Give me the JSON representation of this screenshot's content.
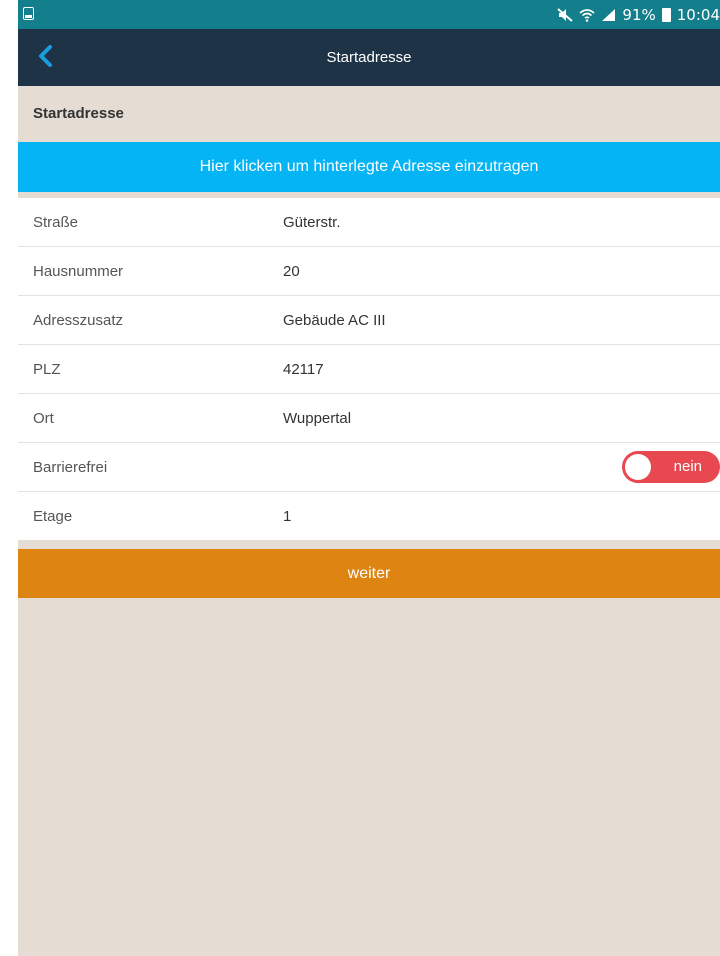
{
  "status_bar": {
    "battery_percent": "91%",
    "time": "10:04",
    "icons": [
      "screenshot-icon",
      "mute-icon",
      "wifi-icon",
      "signal-icon",
      "battery-icon"
    ]
  },
  "nav": {
    "title": "Startadresse",
    "back_icon": "chevron-left-icon"
  },
  "section": {
    "title": "Startadresse",
    "fill_button_label": "Hier klicken um hinterlegte Adresse einzutragen"
  },
  "form": {
    "strasse": {
      "label": "Straße",
      "value": "Güterstr."
    },
    "hausnummer": {
      "label": "Hausnummer",
      "value": "20"
    },
    "adresszusatz": {
      "label": "Adresszusatz",
      "value": "Gebäude AC III"
    },
    "plz": {
      "label": "PLZ",
      "value": "42117"
    },
    "ort": {
      "label": "Ort",
      "value": "Wuppertal"
    },
    "barrierefrei": {
      "label": "Barrierefrei",
      "toggle_label": "nein",
      "toggle_on": false
    },
    "etage": {
      "label": "Etage",
      "value": "1"
    }
  },
  "next_button_label": "weiter",
  "colors": {
    "status_bar": "#137f8c",
    "nav_bar": "#1e3346",
    "accent_blue": "#04b4f4",
    "toggle_off": "#e8484f",
    "next_orange": "#dd8413",
    "background": "#e5ddd3"
  }
}
